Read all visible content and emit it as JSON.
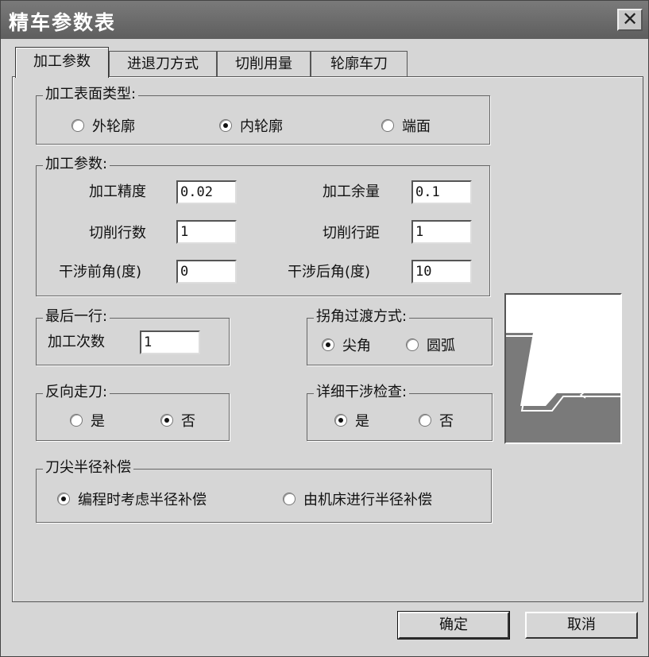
{
  "window": {
    "title": "精车参数表",
    "close_glyph": "✕"
  },
  "tabs": [
    {
      "label": "加工参数",
      "active": true
    },
    {
      "label": "进退刀方式",
      "active": false
    },
    {
      "label": "切削用量",
      "active": false
    },
    {
      "label": "轮廓车刀",
      "active": false
    }
  ],
  "surface_type": {
    "legend": "加工表面类型:",
    "options": [
      {
        "label": "外轮廓",
        "selected": false
      },
      {
        "label": "内轮廓",
        "selected": true
      },
      {
        "label": "端面",
        "selected": false
      }
    ]
  },
  "params": {
    "legend": "加工参数:",
    "precision_label": "加工精度",
    "precision_value": "0.02",
    "allowance_label": "加工余量",
    "allowance_value": "0.1",
    "rows_label": "切削行数",
    "rows_value": "1",
    "spacing_label": "切削行距",
    "spacing_value": "1",
    "front_angle_label": "干涉前角(度)",
    "front_angle_value": "0",
    "back_angle_label": "干涉后角(度)",
    "back_angle_value": "10"
  },
  "last_row": {
    "legend": "最后一行:",
    "count_label": "加工次数",
    "count_value": "1"
  },
  "corner": {
    "legend": "拐角过渡方式:",
    "options": [
      {
        "label": "尖角",
        "selected": true
      },
      {
        "label": "圆弧",
        "selected": false
      }
    ]
  },
  "reverse": {
    "legend": "反向走刀:",
    "options": [
      {
        "label": "是",
        "selected": false
      },
      {
        "label": "否",
        "selected": true
      }
    ]
  },
  "interference": {
    "legend": "详细干涉检查:",
    "options": [
      {
        "label": "是",
        "selected": true
      },
      {
        "label": "否",
        "selected": false
      }
    ]
  },
  "compensation": {
    "legend": "刀尖半径补偿",
    "options": [
      {
        "label": "编程时考虑半径补偿",
        "selected": true
      },
      {
        "label": "由机床进行半径补偿",
        "selected": false
      }
    ]
  },
  "buttons": {
    "ok": "确定",
    "cancel": "取消"
  },
  "colors": {
    "titlebar": "#6a6a6a",
    "face": "#d6d6d6",
    "preview_fill": "#7a7a7a"
  }
}
